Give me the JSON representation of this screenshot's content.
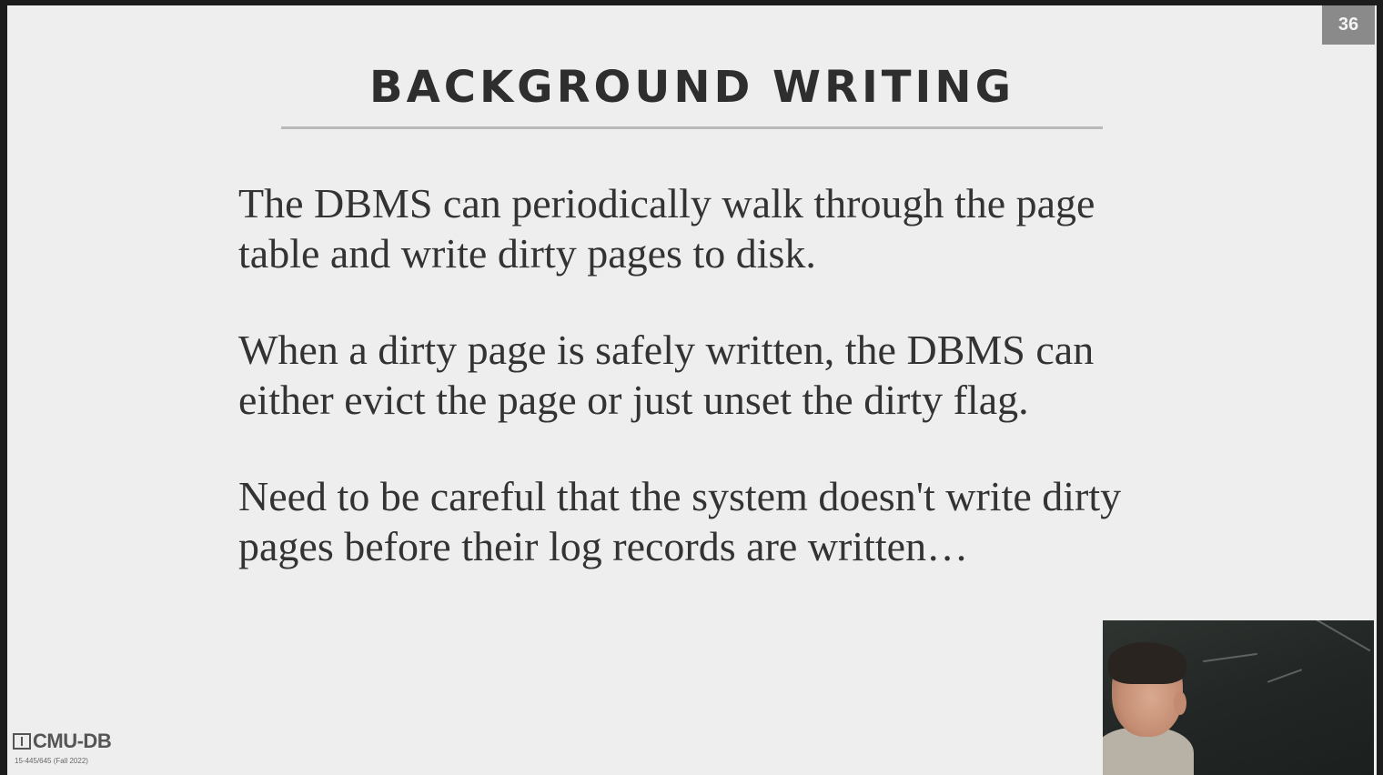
{
  "slide": {
    "number": "36",
    "title": "BACKGROUND WRITING",
    "bullets": [
      "The DBMS can periodically walk through the page table and write dirty pages to disk.",
      "When a dirty page is safely written, the DBMS can either evict the page or just unset the dirty flag.",
      "Need to be careful that the system doesn't write dirty pages before their log records are written…"
    ]
  },
  "logo": {
    "name": "CMU-DB",
    "course": "15-445/645 (Fall 2022)"
  },
  "webcam": {
    "icon": "presenter-video"
  }
}
